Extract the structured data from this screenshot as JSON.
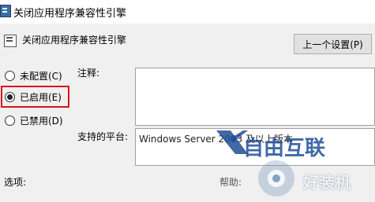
{
  "window": {
    "title": "关闭应用程序兼容性引擎"
  },
  "policy": {
    "title": "关闭应用程序兼容性引擎"
  },
  "buttons": {
    "prev_setting": "上一个设置(P)"
  },
  "options": [
    {
      "label": "未配置(C)",
      "selected": false
    },
    {
      "label": "已启用(E)",
      "selected": true
    },
    {
      "label": "已禁用(D)",
      "selected": false
    }
  ],
  "labels": {
    "comment": "注释:",
    "supported_platforms": "支持的平台:",
    "options": "选项:",
    "help": "帮助:"
  },
  "fields": {
    "comment_value": "",
    "platforms_value": "Windows Server 2003 及以上版本"
  },
  "watermark": {
    "brand_top": "自由互联",
    "brand_bottom": "好装机"
  },
  "colors": {
    "highlight_border": "#d9141b",
    "window_bg": "#f0f0f0",
    "button_bg": "#e1e1e1"
  }
}
